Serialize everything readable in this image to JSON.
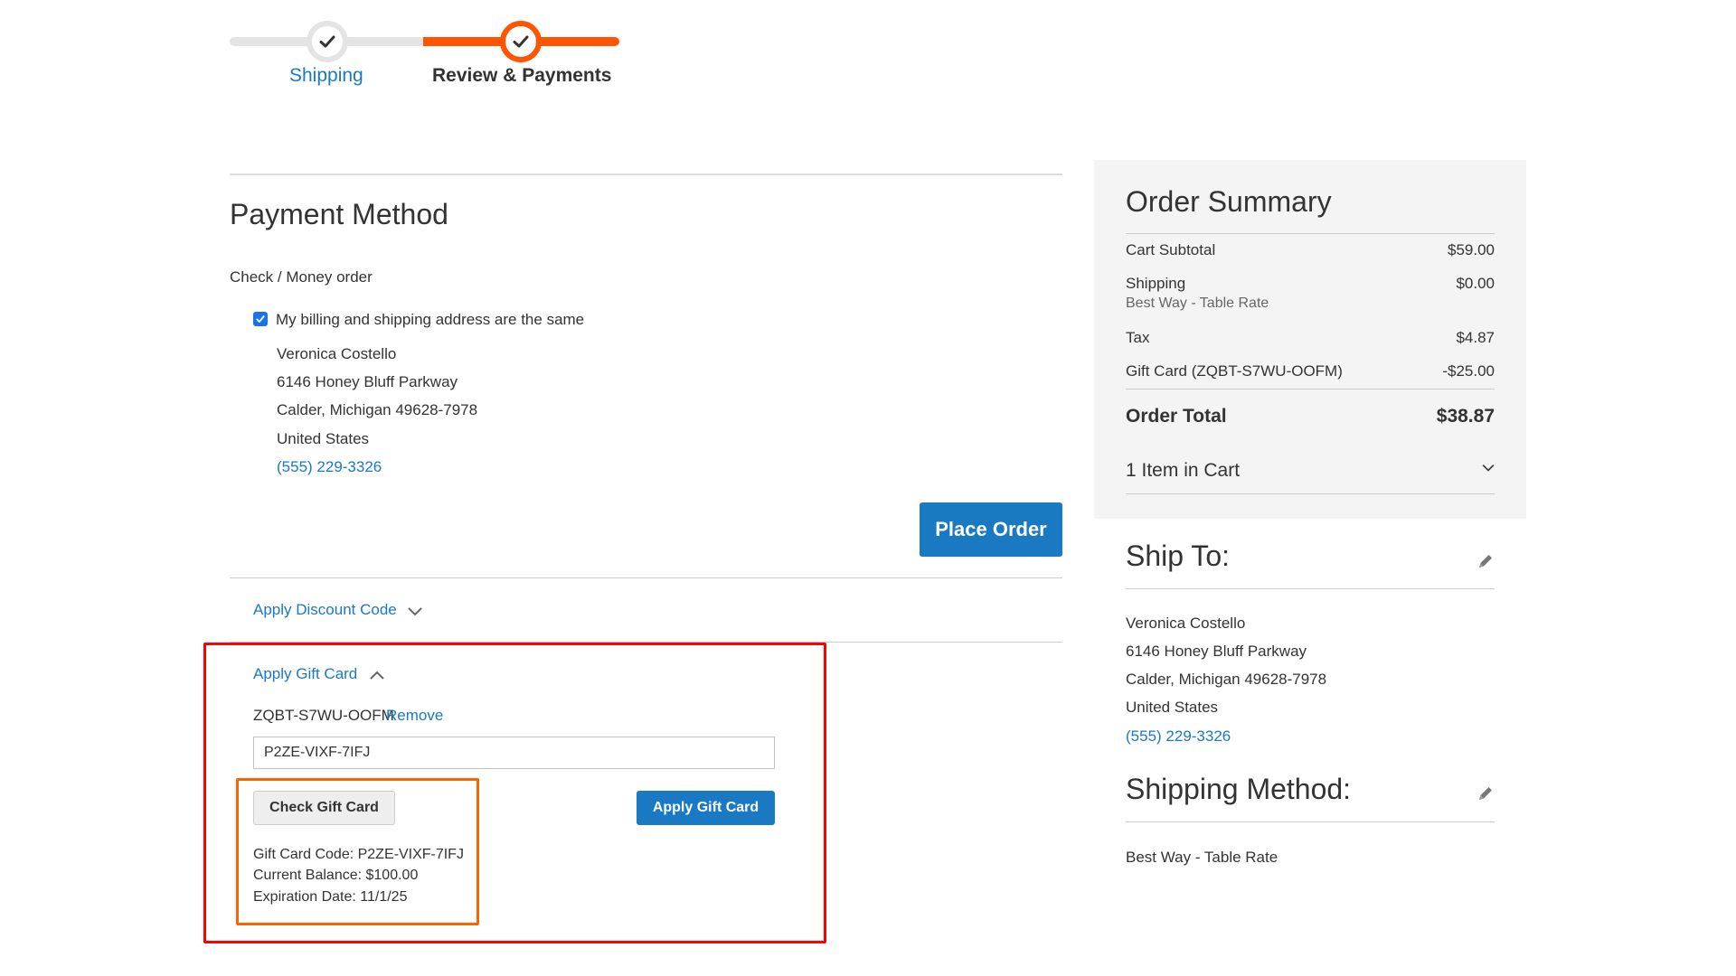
{
  "progress": {
    "steps": [
      {
        "label": "Shipping",
        "state": "complete"
      },
      {
        "label": "Review & Payments",
        "state": "active"
      }
    ],
    "colors": {
      "active": "#ff5501",
      "inactive": "#e4e4e4",
      "link": "#1979c3"
    }
  },
  "payment": {
    "title": "Payment Method",
    "method_label": "Check / Money order",
    "same_address_label": "My billing and shipping address are the same",
    "same_address_checked": true,
    "address": {
      "name": "Veronica Costello",
      "street": "6146 Honey Bluff Parkway",
      "city_line": "Calder, Michigan 49628-7978",
      "country": "United States",
      "phone": "(555) 229-3326"
    },
    "place_order_label": "Place Order"
  },
  "discount": {
    "toggle_label": "Apply Discount Code",
    "expanded": false
  },
  "gift_card": {
    "toggle_label": "Apply Gift Card",
    "expanded": true,
    "applied_code": "ZQBT-S7WU-OOFM",
    "remove_label": "Remove",
    "input_value": "P2ZE-VIXF-7IFJ",
    "check_button_label": "Check Gift Card",
    "apply_button_label": "Apply Gift Card",
    "info": {
      "code_line": "Gift Card Code: P2ZE-VIXF-7IFJ",
      "balance_line": "Current Balance: $100.00",
      "expiration_line": "Expiration Date: 11/1/25"
    },
    "highlight_colors": {
      "outer": "#ff0000",
      "inner": "#ff6200"
    }
  },
  "summary": {
    "title": "Order Summary",
    "rows": [
      {
        "label": "Cart Subtotal",
        "value": "$59.00"
      },
      {
        "label": "Shipping",
        "value": "$0.00",
        "sub": "Best Way - Table Rate"
      },
      {
        "label": "Tax",
        "value": "$4.87"
      },
      {
        "label": "Gift Card (ZQBT-S7WU-OOFM)",
        "value": "-$25.00"
      }
    ],
    "total_label": "Order Total",
    "total_value": "$38.87",
    "items_in_cart": "1 Item in Cart"
  },
  "ship_to": {
    "title": "Ship To:",
    "name": "Veronica Costello",
    "street": "6146 Honey Bluff Parkway",
    "city_line": "Calder, Michigan 49628-7978",
    "country": "United States",
    "phone": "(555) 229-3326"
  },
  "shipping_method": {
    "title": "Shipping Method:",
    "value": "Best Way - Table Rate"
  }
}
